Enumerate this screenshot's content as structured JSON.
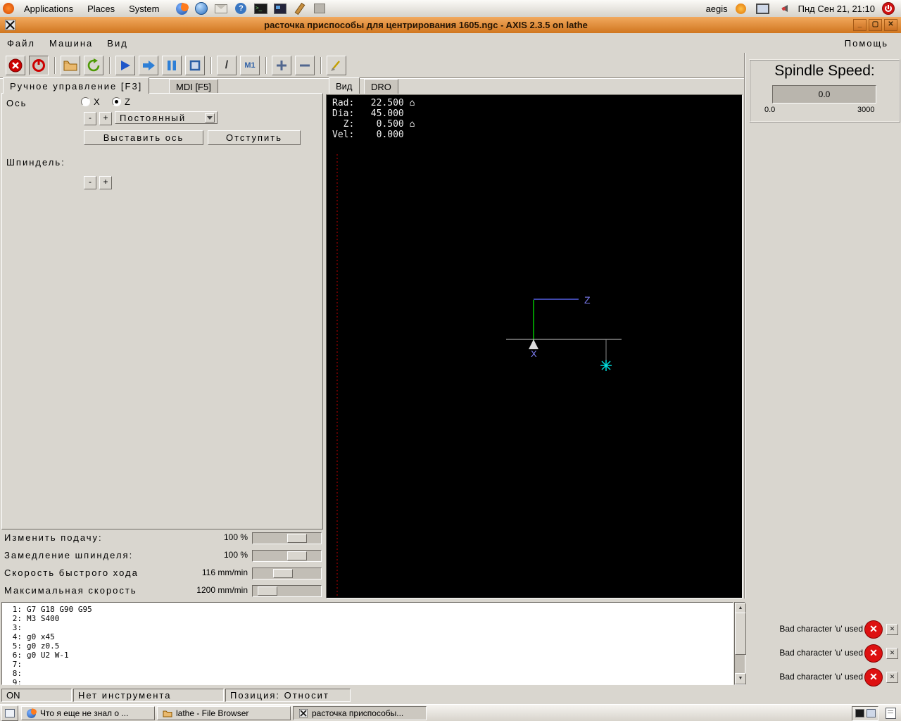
{
  "desktop": {
    "menus": [
      "Applications",
      "Places",
      "System"
    ],
    "launcher_icons": [
      "firefox-icon",
      "web-browser-icon",
      "mail-icon",
      "help-icon",
      "terminal-icon",
      "tools-icon",
      "package-icon"
    ],
    "username": "aegis",
    "clock": "Пнд Сен 21, 21:10"
  },
  "window": {
    "title": "расточка приспособы для центрирования 1605.ngc - AXIS 2.3.5 on lathe",
    "buttons": {
      "minimize": "_",
      "maximize": "▢",
      "close": "✕"
    },
    "menu_items": [
      "Файл",
      "Машина",
      "Вид"
    ],
    "menu_help": "Помощь"
  },
  "toolbar": {
    "buttons": [
      "estop",
      "machine-power",
      "open-file",
      "reload-file",
      "run-program",
      "run-step",
      "pause",
      "stop",
      "toggle-skip-lines",
      "toggle-optional-pause",
      "zoom-in",
      "zoom-out",
      "clear-plot"
    ],
    "skip_glyph": "/",
    "optpause_glyph": "M1"
  },
  "left_panel": {
    "tab_manual": "Ручное управление [F3]",
    "tab_mdi": "MDI [F5]",
    "axis_label": "Ось",
    "axis_x": "X",
    "axis_z": "Z",
    "jog_minus": "-",
    "jog_plus": "+",
    "jog_mode": "Постоянный",
    "home_button": "Выставить ось",
    "offset_button": "Отступить",
    "spindle_label": "Шпиндель:",
    "spindle_minus": "-",
    "spindle_plus": "+"
  },
  "overrides": {
    "rows": [
      {
        "label": "Изменить подачу:",
        "value": "100 %"
      },
      {
        "label": "Замедление шпинделя:",
        "value": "100 %"
      },
      {
        "label": "Скорость быстрого хода",
        "value": "116 mm/min"
      },
      {
        "label": "Максимальная скорость",
        "value": "1200 mm/min"
      }
    ]
  },
  "preview": {
    "tab_view": "Вид",
    "tab_dro": "DRO",
    "dro_lines": [
      "Rad:   22.500 ⌂",
      "Dia:   45.000",
      "  Z:    0.500 ⌂",
      "Vel:    0.000"
    ],
    "axis_z_label": "Z",
    "axis_x_label": "X"
  },
  "spindle_box": {
    "title": "Spindle Speed:",
    "value": "0.0",
    "min": "0.0",
    "max": "3000"
  },
  "gcode": {
    "lines": [
      {
        "num": "1:",
        "code": "G7 G18 G90 G95"
      },
      {
        "num": "2:",
        "code": "M3 S400"
      },
      {
        "num": "3:",
        "code": ""
      },
      {
        "num": "4:",
        "code": "g0 x45"
      },
      {
        "num": "5:",
        "code": "g0 z0.5"
      },
      {
        "num": "6:",
        "code": "g0 U2 W-1"
      },
      {
        "num": "7:",
        "code": ""
      },
      {
        "num": "8:",
        "code": ""
      },
      {
        "num": "9:",
        "code": ""
      }
    ]
  },
  "statusbar": {
    "power": "ON",
    "tool": "Нет инструмента",
    "position": "Позиция: Относит"
  },
  "errors": [
    "Bad character 'u' used",
    "Bad character 'u' used",
    "Bad character 'u' used"
  ],
  "taskbar": {
    "tasks": [
      {
        "label": "Что я еще не знал о ..."
      },
      {
        "label": "lathe - File Browser"
      },
      {
        "label": "расточка приспособы..."
      }
    ]
  }
}
